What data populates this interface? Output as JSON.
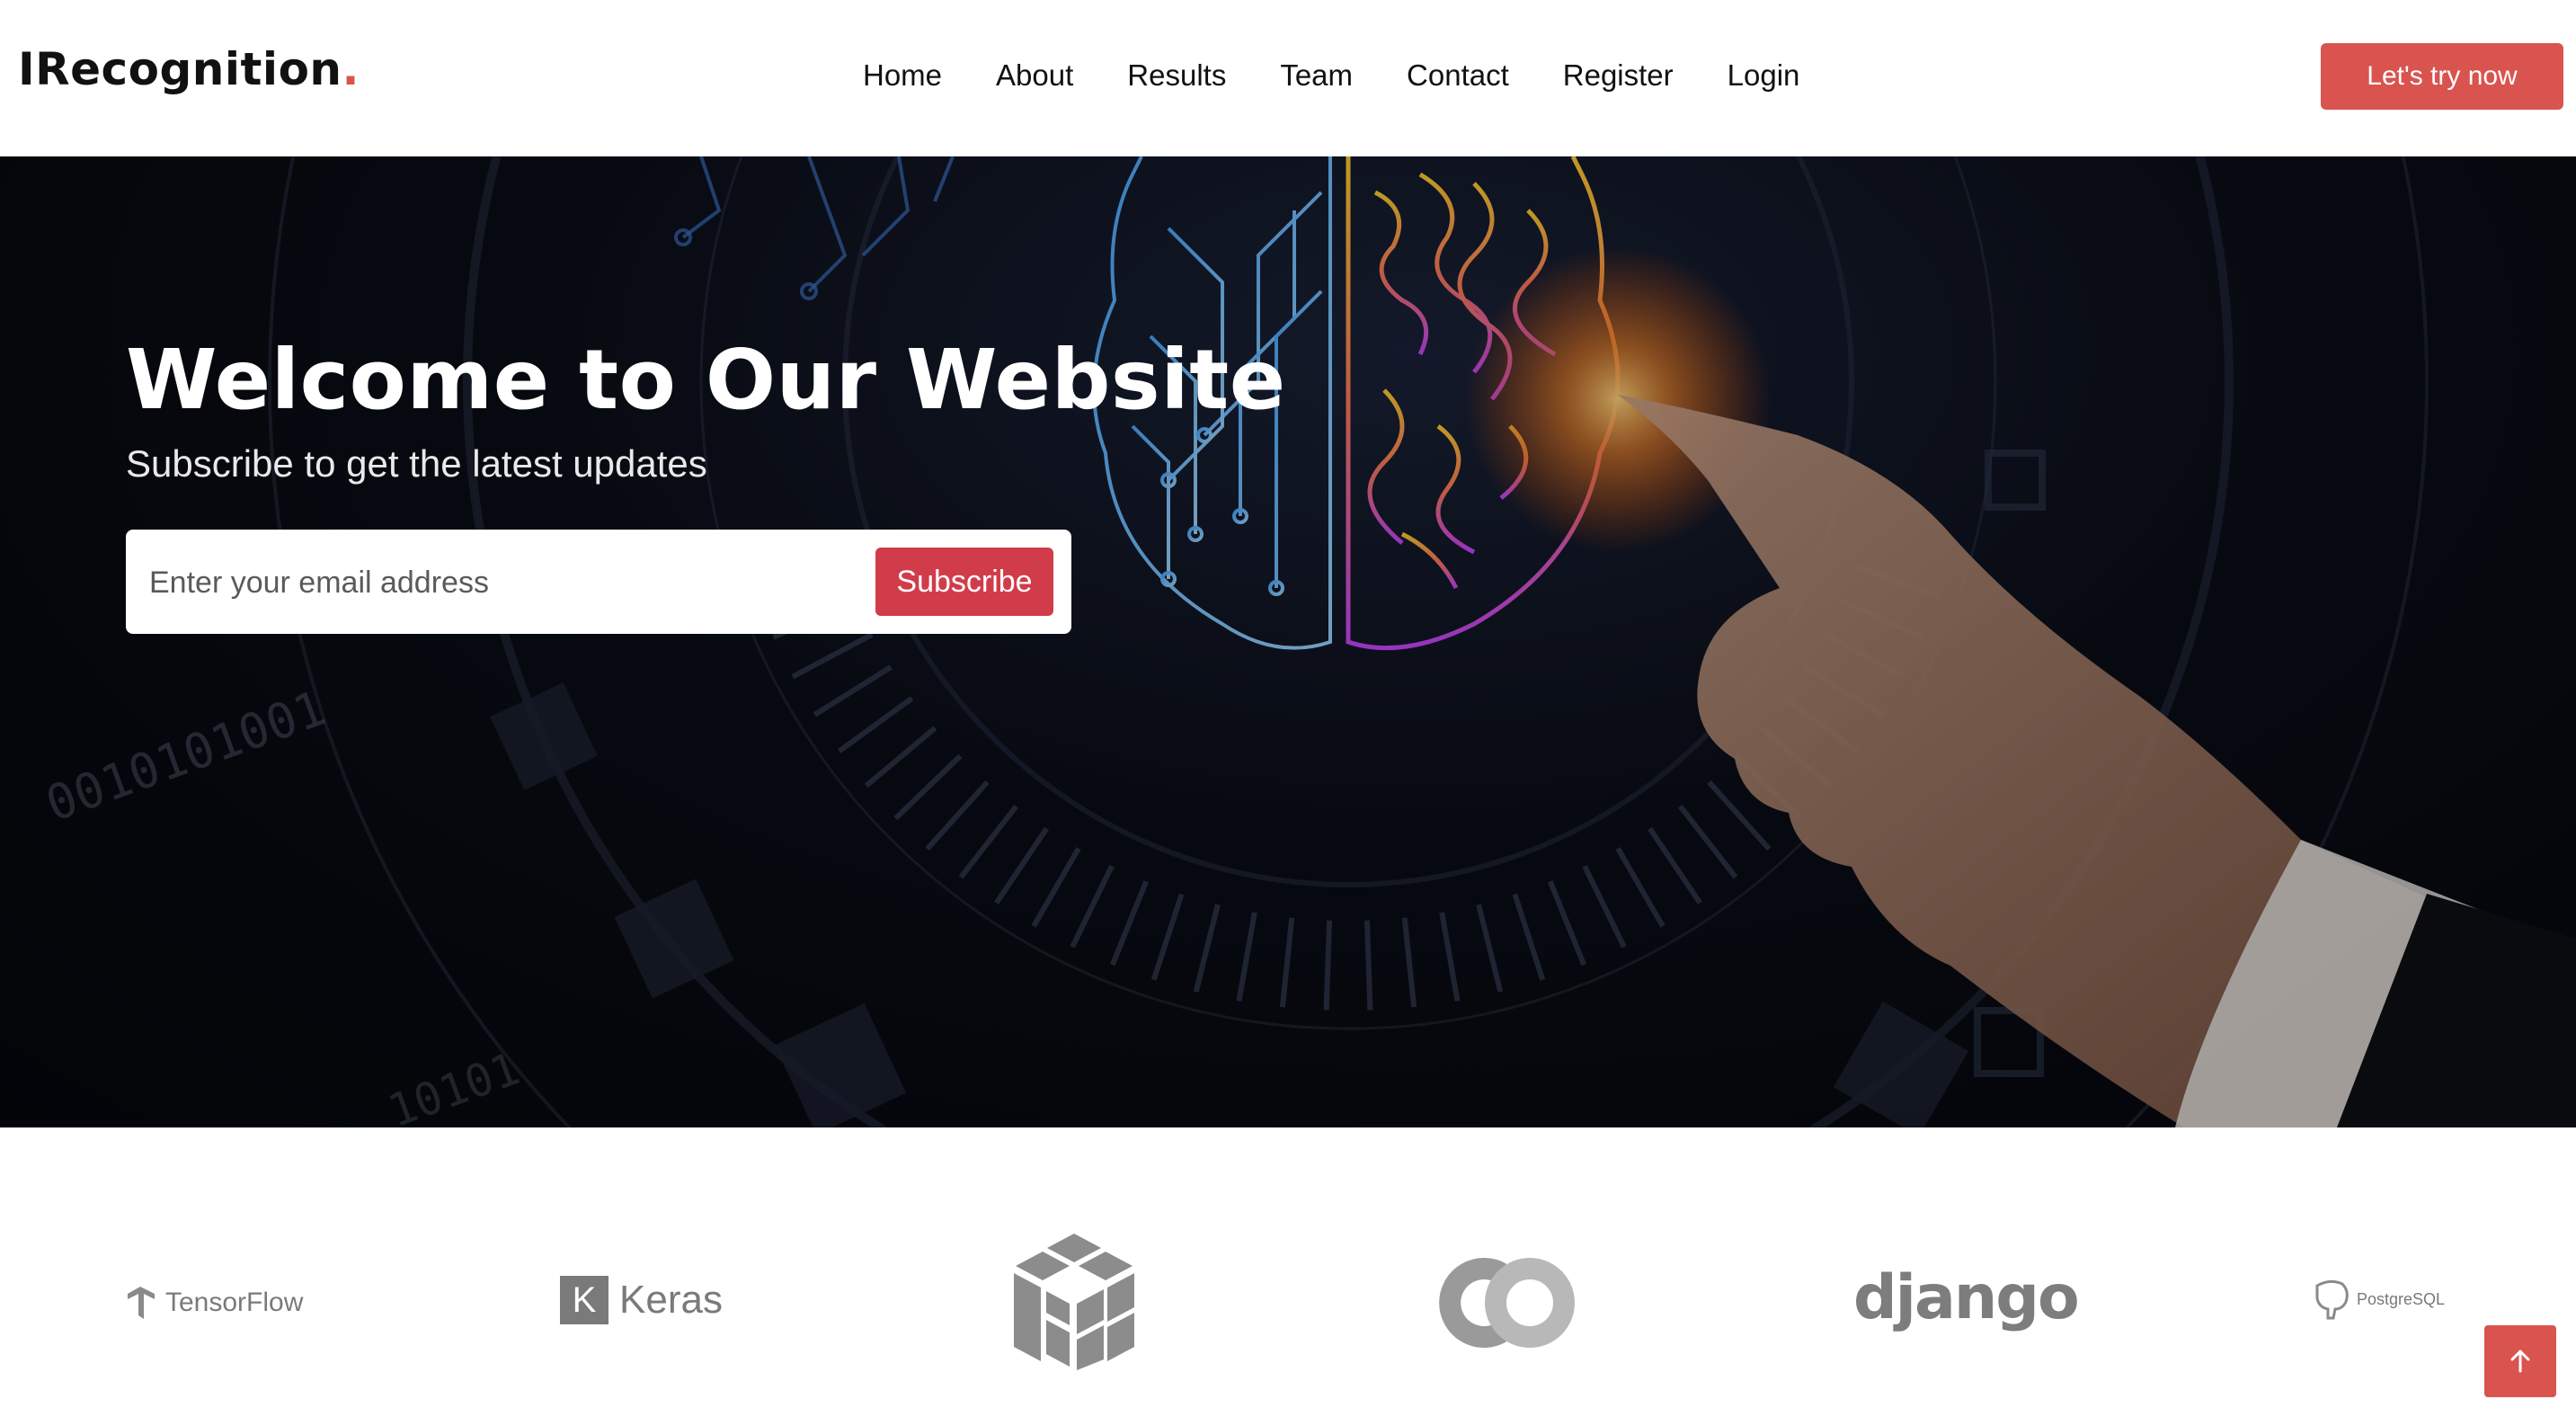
{
  "header": {
    "logo_text": "IRecognition",
    "logo_dot": ".",
    "nav": [
      "Home",
      "About",
      "Results",
      "Team",
      "Contact",
      "Register",
      "Login"
    ],
    "cta_label": "Let's try now"
  },
  "hero": {
    "title": "Welcome to Our Website",
    "subtitle": "Subscribe to get the latest updates",
    "email_placeholder": "Enter your email address",
    "subscribe_label": "Subscribe",
    "binary_text_1": "0010101001",
    "binary_text_2": "10101"
  },
  "logos": {
    "tensorflow": "TensorFlow",
    "keras": "Keras",
    "keras_mark": "K",
    "django": "django",
    "postgresql": "PostgreSQL"
  },
  "colors": {
    "accent": "#d9534f",
    "subscribe": "#d13c4a",
    "hero_bg": "#0a0d16",
    "logo_gray": "#7a7a7a"
  },
  "icons": {
    "back_to_top": "arrow-up-icon"
  }
}
